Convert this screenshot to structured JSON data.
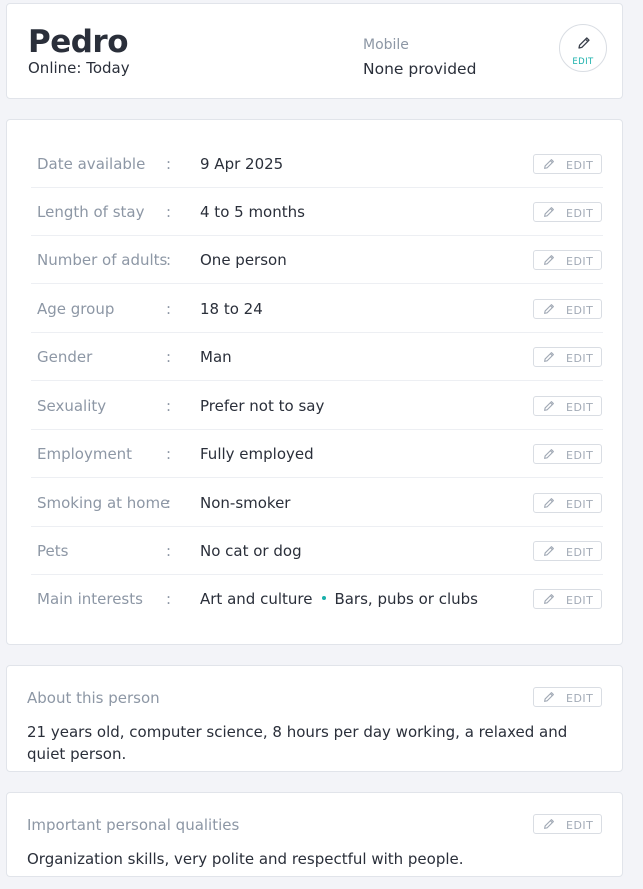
{
  "header": {
    "name": "Pedro",
    "online": "Online: Today",
    "mobile_label": "Mobile",
    "mobile_value": "None provided",
    "edit_label": "EDIT"
  },
  "details": {
    "edit_label": "EDIT",
    "rows": [
      {
        "label": "Date available",
        "colon": ":",
        "value": "9 Apr 2025"
      },
      {
        "label": "Length of stay",
        "colon": ":",
        "value": "4 to 5 months"
      },
      {
        "label": "Number of adults",
        "colon": ":",
        "value": "One person"
      },
      {
        "label": "Age group",
        "colon": ":",
        "value": "18 to 24"
      },
      {
        "label": "Gender",
        "colon": ":",
        "value": "Man"
      },
      {
        "label": "Sexuality",
        "colon": ":",
        "value": "Prefer not to say"
      },
      {
        "label": "Employment",
        "colon": ":",
        "value": "Fully employed"
      },
      {
        "label": "Smoking at home",
        "colon": ":",
        "value": "Non-smoker"
      },
      {
        "label": "Pets",
        "colon": ":",
        "value": "No cat or dog"
      },
      {
        "label": "Main interests",
        "colon": ":",
        "value": "Art and culture",
        "value2": "Bars, pubs or clubs"
      }
    ]
  },
  "about": {
    "title": "About this person",
    "text": "21 years old, computer science, 8 hours per day working, a relaxed and quiet person.",
    "edit_label": "EDIT"
  },
  "qualities": {
    "title": "Important personal qualities",
    "text": "Organization skills, very polite and respectful with people.",
    "edit_label": "EDIT"
  },
  "colors": {
    "accent": "#19b0ab",
    "muted_text": "#8d97a5",
    "main_text": "#2a2f3a",
    "background": "#f3f4f8"
  },
  "icons": {
    "edit": "pencil-icon"
  }
}
